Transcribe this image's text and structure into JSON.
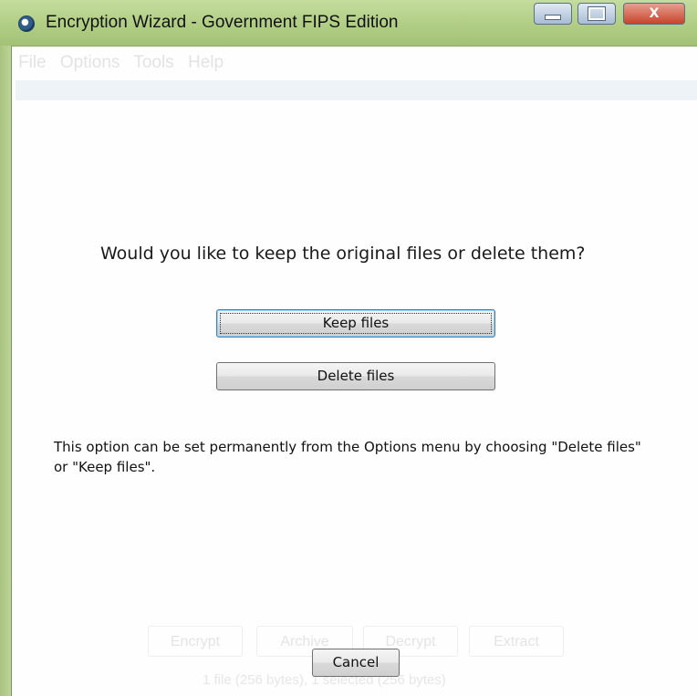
{
  "window": {
    "title": "Encryption Wizard - Government FIPS Edition",
    "minimize_icon": "minimize-icon",
    "maximize_icon": "maximize-icon",
    "close_label": "X",
    "title_bar_color": "#b4d088"
  },
  "background": {
    "menu": [
      "File",
      "Options",
      "Tools",
      "Help"
    ],
    "buttons": [
      "Encrypt",
      "Archive",
      "Decrypt",
      "Extract"
    ],
    "status": "1 file (256 bytes), 1 selected (256 bytes)"
  },
  "dialog": {
    "question": "Would you like to keep the original files or delete them?",
    "keep_label": "Keep files",
    "delete_label": "Delete files",
    "info": "This option can be set permanently from the Options menu by choosing \"Delete files\" or \"Keep files\".",
    "cancel_label": "Cancel"
  }
}
